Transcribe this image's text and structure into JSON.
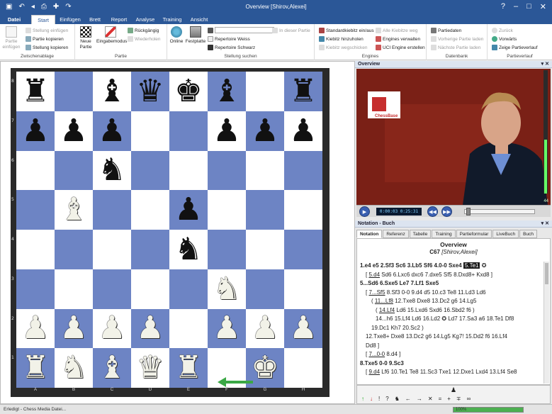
{
  "window": {
    "title": "Overview  [Shirov,Alexei]"
  },
  "quick_access": [
    "save-icon",
    "undo-icon",
    "back-icon",
    "print-icon",
    "new-icon",
    "redo-icon"
  ],
  "window_controls": [
    "?",
    "minimize",
    "maximize",
    "close"
  ],
  "tabs": [
    "Datei",
    "Start",
    "Einfügen",
    "Brett",
    "Report",
    "Analyse",
    "Training",
    "Ansicht"
  ],
  "active_tab": "Start",
  "ribbon": {
    "zwischenablage": {
      "label": "Zwischenablage",
      "partie_einfuegen": "Partie einfügen",
      "stellung_einfuegen": "Stellung einfügen",
      "partie_kopieren": "Partie kopieren",
      "stellung_kopieren": "Stellung kopieren"
    },
    "partie": {
      "label": "Partie",
      "neue_partie": "Neue Partie",
      "eingabemodus": "Eingabemodus",
      "rueckgaengig": "Rückgängig",
      "wiederholen": "Wiederholen"
    },
    "stellung_suchen": {
      "label": "Stellung suchen",
      "online": "Online",
      "festplatte": "Festplatte",
      "repertoire_weiss": "Repertoire Weiss",
      "repertoire_schwarz": "Repertoire Schwarz",
      "in_dieser_partie": "In dieser Partie"
    },
    "engines": {
      "label": "Engines",
      "standardkiebitz": "Standardkiebitz ein/aus",
      "kiebitz_hinzuholen": "Kiebitz hinzuholen",
      "kiebitz_wegschicken": "Kiebitz wegschicken",
      "alle_kiebitze": "Alle Kiebitze weg",
      "engines_verwalten": "Engines verwalten",
      "uci": "UCI Engine erstellen"
    },
    "datenbank": {
      "label": "Datenbank",
      "partiedaten": "Partiedaten",
      "vorherige": "Vorherige Partie laden",
      "naechste": "Nächste Partie laden"
    },
    "partieverlauf": {
      "label": "Partieverlauf",
      "zurueck": "Zurück",
      "vorwaerts": "Vorwärts",
      "zeige": "Zeige Partieverlauf"
    }
  },
  "board": {
    "files": [
      "A",
      "B",
      "C",
      "D",
      "E",
      "F",
      "G",
      "H"
    ],
    "ranks": [
      "8",
      "7",
      "6",
      "5",
      "4",
      "3",
      "2",
      "1"
    ],
    "position": [
      [
        "r",
        "",
        "b",
        "q",
        "k",
        "b",
        "",
        "r"
      ],
      [
        "p",
        "p",
        "p",
        "",
        "",
        "p",
        "p",
        "p"
      ],
      [
        "",
        "",
        "n",
        "",
        "",
        "",
        "",
        ""
      ],
      [
        "",
        "B",
        "",
        "",
        "p",
        "",
        "",
        ""
      ],
      [
        "",
        "",
        "",
        "",
        "n",
        "",
        "",
        ""
      ],
      [
        "",
        "",
        "",
        "",
        "",
        "N",
        "",
        ""
      ],
      [
        "P",
        "P",
        "P",
        "P",
        "",
        "P",
        "P",
        "P"
      ],
      [
        "R",
        "N",
        "B",
        "Q",
        "R",
        "",
        "K",
        ""
      ]
    ],
    "last_move_arrow": {
      "from": "f1",
      "to": "e1",
      "color": "#3aa845"
    }
  },
  "overview_panel": {
    "title": "Overview",
    "logo": "ChessBase"
  },
  "video": {
    "time": "0:00:03 0:25:31",
    "volume": "44"
  },
  "notation_panel": {
    "title": "Notation - Buch"
  },
  "notation_tabs": [
    "Notation",
    "Referenz",
    "Tabelle",
    "Training",
    "Partieformular",
    "LiveBuch",
    "Buch"
  ],
  "active_notation_tab": "Notation",
  "game": {
    "title": "Overview",
    "eco": "C67",
    "player": "[Shirov,Alexei]"
  },
  "moves": [
    {
      "cls": "mv",
      "html": "<b>1.e4 e5 2.Sf3 Sc6 3.Lb5 Sf6 4.0-0 Sxe4</b> <span class=\"cur\">5.Te1</span> ✪"
    },
    {
      "cls": "var",
      "html": "[ <u>5.d4</u> Sd6 6.Lxc6 dxc6 7.dxe5 Sf5 8.Dxd8+ Kxd8 ]"
    },
    {
      "cls": "mv",
      "html": "<b>5...Sd6 6.Sxe5 Le7 7.Lf1 Sxe5</b>"
    },
    {
      "cls": "var",
      "html": "[ <u>7...Sf5</u> 8.Sf3 0-0 9.d4 d5 10.c3 Te8 11.Ld3 Ld6"
    },
    {
      "cls": "var2",
      "html": "( <u>11...Lf8</u> 12.Txe8 Dxe8 13.Dc2 g6 14.Lg5"
    },
    {
      "cls": "var3",
      "html": "( <u>14.Lf4</u> Ld6 15.Lxd6 Sxd6 16.Sbd2 f6 )"
    },
    {
      "cls": "var3",
      "html": "14...h6 15.Lf4 Ld6 16.Ld2 ✪ Ld7 17.Sa3 a6 18.Te1 Df8"
    },
    {
      "cls": "var2",
      "html": "19.Dc1 Kh7 20.Sc2 )"
    },
    {
      "cls": "var",
      "html": "12.Txe8+ Dxe8 13.Dc2 g6 14.Lg5 Kg7! 15.Dd2 f6 16.Lf4"
    },
    {
      "cls": "var",
      "html": "Dd8 ]"
    },
    {
      "cls": "var",
      "html": "[ <u>7...0-0</u> 8.d4 ]"
    },
    {
      "cls": "mv",
      "html": "<b>8.Txe5 0-0 9.Sc3</b>"
    },
    {
      "cls": "var",
      "html": "[ <u>9.d4</u> Lf6 10.Te1 Te8 11.Sc3 Txe1 12.Dxe1 Lxd4 13.Lf4 Se8"
    }
  ],
  "statusbar": {
    "text": "Erledigt - Chess Media Datei...",
    "zoom": "100%",
    "zoom_value": 1.0
  }
}
